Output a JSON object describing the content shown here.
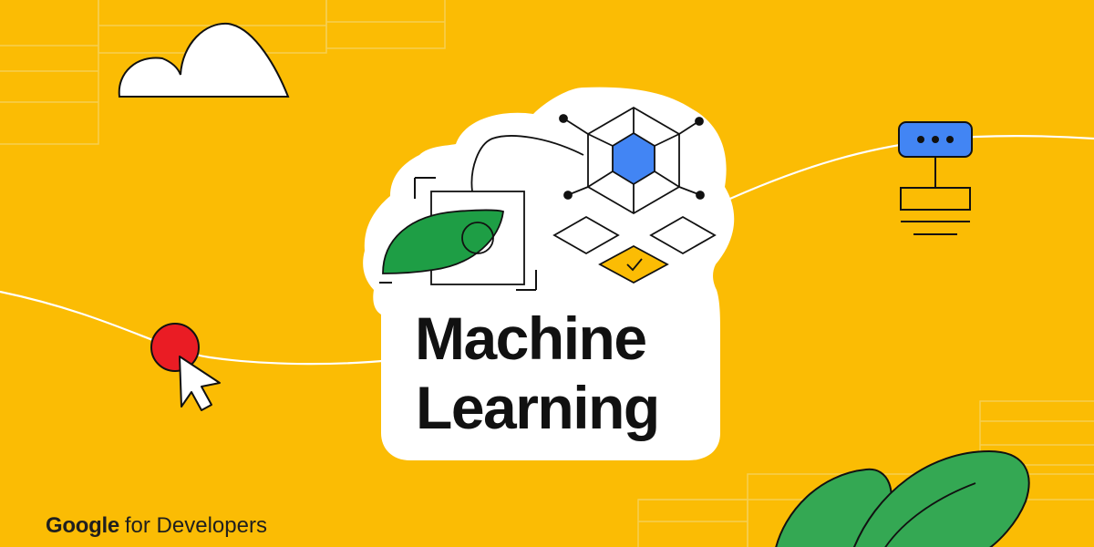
{
  "title": {
    "line1": "Machine",
    "line2": "Learning"
  },
  "brand": {
    "google": "Google",
    "suffix": "for Developers"
  },
  "colors": {
    "background": "#FBBC04",
    "card": "#FFFFFF",
    "outline": "#111111",
    "leaf_green": "#1E9E45",
    "plant_green": "#34A853",
    "node_blue": "#4285F4",
    "cursor_red": "#EA1C24",
    "grid_line": "#F6CE52",
    "check_fill": "#FBBC04"
  },
  "icons": [
    "cloud-icon",
    "leaf-in-frame-icon",
    "neural-node-hexagon-icon",
    "diamond-option-icon",
    "diamond-check-icon",
    "flowchart-node-icon",
    "red-dot-icon",
    "cursor-arrow-icon",
    "plant-leaves-icon"
  ]
}
